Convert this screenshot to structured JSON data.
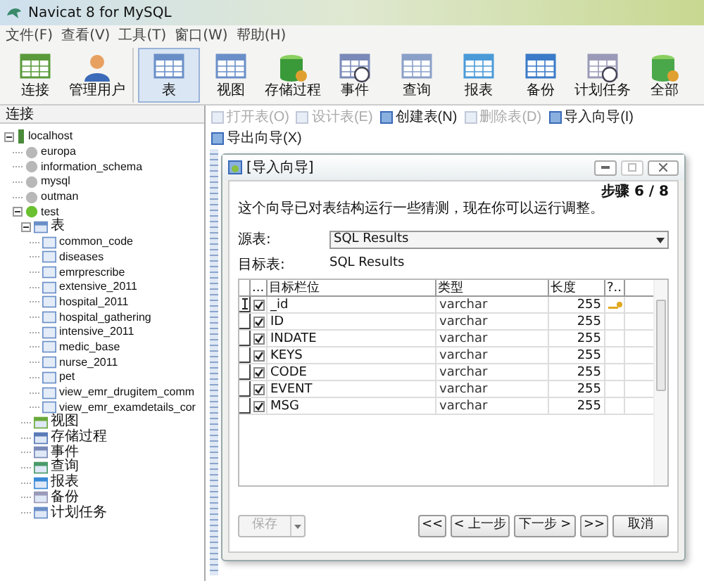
{
  "window": {
    "title": "Navicat 8 for MySQL"
  },
  "menu": [
    "文件(F)",
    "查看(V)",
    "工具(T)",
    "窗口(W)",
    "帮助(H)"
  ],
  "toolbar": [
    {
      "label": "连接",
      "selected": false
    },
    {
      "label": "管理用户",
      "selected": false
    },
    {
      "label": "表",
      "selected": true
    },
    {
      "label": "视图",
      "selected": false
    },
    {
      "label": "存储过程",
      "selected": false
    },
    {
      "label": "事件",
      "selected": false
    },
    {
      "label": "查询",
      "selected": false
    },
    {
      "label": "报表",
      "selected": false
    },
    {
      "label": "备份",
      "selected": false
    },
    {
      "label": "计划任务",
      "selected": false
    },
    {
      "label": "全部",
      "selected": false
    }
  ],
  "sidebar": {
    "title": "连接",
    "tree": [
      {
        "label": "localhost",
        "kind": "server",
        "expanded": true,
        "children": [
          {
            "label": "europa",
            "kind": "database",
            "connected": false
          },
          {
            "label": "information_schema",
            "kind": "database",
            "connected": false
          },
          {
            "label": "mysql",
            "kind": "database",
            "connected": false
          },
          {
            "label": "outman",
            "kind": "database",
            "connected": false
          },
          {
            "label": "test",
            "kind": "database",
            "connected": true,
            "expanded": true,
            "children": [
              {
                "label": "表",
                "kind": "group",
                "expanded": true,
                "children": [
                  {
                    "label": "common_code",
                    "kind": "table"
                  },
                  {
                    "label": "diseases",
                    "kind": "table"
                  },
                  {
                    "label": "emrprescribe",
                    "kind": "table"
                  },
                  {
                    "label": "extensive_2011",
                    "kind": "table"
                  },
                  {
                    "label": "hospital_2011",
                    "kind": "table"
                  },
                  {
                    "label": "hospital_gathering",
                    "kind": "table"
                  },
                  {
                    "label": "intensive_2011",
                    "kind": "table"
                  },
                  {
                    "label": "medic_base",
                    "kind": "table"
                  },
                  {
                    "label": "nurse_2011",
                    "kind": "table"
                  },
                  {
                    "label": "pet",
                    "kind": "table"
                  },
                  {
                    "label": "view_emr_drugitem_comm",
                    "kind": "table"
                  },
                  {
                    "label": "view_emr_examdetails_cor",
                    "kind": "table"
                  }
                ]
              },
              {
                "label": "视图",
                "kind": "group"
              },
              {
                "label": "存储过程",
                "kind": "group"
              },
              {
                "label": "事件",
                "kind": "group"
              },
              {
                "label": "查询",
                "kind": "group"
              },
              {
                "label": "报表",
                "kind": "group"
              },
              {
                "label": "备份",
                "kind": "group"
              },
              {
                "label": "计划任务",
                "kind": "group"
              }
            ]
          }
        ]
      }
    ]
  },
  "object_toolbar": [
    {
      "label": "打开表(O)",
      "disabled": true
    },
    {
      "label": "设计表(E)",
      "disabled": true
    },
    {
      "label": "创建表(N)",
      "disabled": false
    },
    {
      "label": "删除表(D)",
      "disabled": true
    },
    {
      "label": "导入向导(I)",
      "disabled": false
    },
    {
      "label": "导出向导(X)",
      "disabled": false
    }
  ],
  "dialog": {
    "title": "[导入向导]",
    "step": "步骤 6 / 8",
    "description": "这个向导已对表结构运行一些猜测，现在你可以运行调整。",
    "source_label": "源表:",
    "source_value": "SQL Results",
    "target_label": "目标表:",
    "target_value": "SQL Results",
    "grid": {
      "columns": [
        "...",
        "目标栏位",
        "类型",
        "长度",
        "?.."
      ],
      "rows": [
        {
          "checked": true,
          "current": true,
          "name": "_id",
          "type": "varchar",
          "length": "255",
          "key": true
        },
        {
          "checked": true,
          "current": false,
          "name": "ID",
          "type": "varchar",
          "length": "255",
          "key": false
        },
        {
          "checked": true,
          "current": false,
          "name": "INDATE",
          "type": "varchar",
          "length": "255",
          "key": false
        },
        {
          "checked": true,
          "current": false,
          "name": "KEYS",
          "type": "varchar",
          "length": "255",
          "key": false
        },
        {
          "checked": true,
          "current": false,
          "name": "CODE",
          "type": "varchar",
          "length": "255",
          "key": false
        },
        {
          "checked": true,
          "current": false,
          "name": "EVENT",
          "type": "varchar",
          "length": "255",
          "key": false
        },
        {
          "checked": true,
          "current": false,
          "name": "MSG",
          "type": "varchar",
          "length": "255",
          "key": false
        }
      ]
    },
    "save_button": {
      "label": "保存",
      "disabled": true
    },
    "nav_buttons": [
      "<<",
      "< 上一步",
      "下一步 >",
      ">>",
      "取消"
    ]
  }
}
